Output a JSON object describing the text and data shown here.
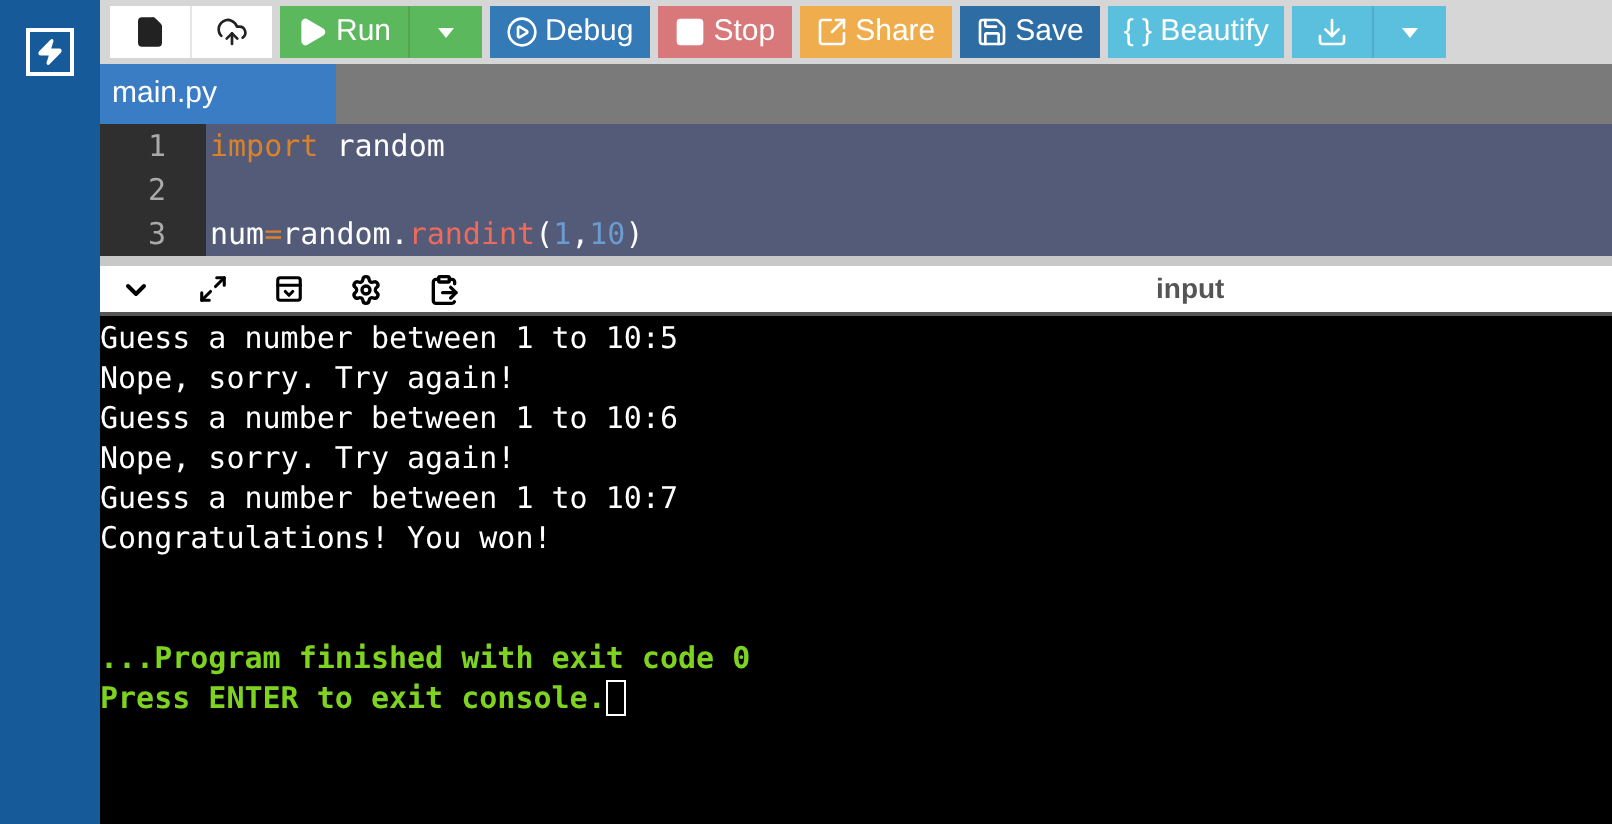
{
  "toolbar": [
    {
      "kind": "new",
      "color": "#ffffff"
    },
    {
      "kind": "upload",
      "color": "#ffffff"
    },
    {
      "kind": "run",
      "label": "Run",
      "color": "#5cb85c"
    },
    {
      "kind": "run-menu",
      "color": "#5cb85c"
    },
    {
      "kind": "debug",
      "label": "Debug",
      "color": "#337ab7"
    },
    {
      "kind": "stop",
      "label": "Stop",
      "color": "#d9787a"
    },
    {
      "kind": "share",
      "label": "Share",
      "color": "#f0ad4e"
    },
    {
      "kind": "save",
      "label": "Save",
      "color": "#2e6da4"
    },
    {
      "kind": "beautify",
      "label": "{ } Beautify",
      "color": "#5bc0de"
    },
    {
      "kind": "download",
      "color": "#5bc0de"
    },
    {
      "kind": "download-menu",
      "color": "#5bc0de"
    }
  ],
  "file_tab": {
    "label": "main.py",
    "selected": true
  },
  "editor": {
    "lines": [
      {
        "number": "1",
        "tokens": [
          {
            "kind": "keyword",
            "text": "import"
          },
          {
            "kind": "plain",
            "text": " random"
          }
        ]
      },
      {
        "number": "2"
      },
      {
        "number": "3",
        "tokens": [
          {
            "kind": "plain",
            "text": "num"
          },
          {
            "kind": "operator",
            "text": "="
          },
          {
            "kind": "plain",
            "text": "random."
          },
          {
            "kind": "function",
            "text": "randint"
          },
          {
            "kind": "plain",
            "text": "("
          },
          {
            "kind": "number",
            "text": "1"
          },
          {
            "kind": "plain",
            "text": ","
          },
          {
            "kind": "number",
            "text": "10"
          },
          {
            "kind": "plain",
            "text": ")"
          }
        ]
      }
    ]
  },
  "console_bar": {
    "label": "input"
  },
  "console": {
    "lines": [
      {
        "kind": "output",
        "text": "Guess a number between 1 to 10:5"
      },
      {
        "kind": "output",
        "text": "Nope, sorry. Try again!"
      },
      {
        "kind": "output",
        "text": "Guess a number between 1 to 10:6"
      },
      {
        "kind": "output",
        "text": "Nope, sorry. Try again!"
      },
      {
        "kind": "output",
        "text": "Guess a number between 1 to 10:7"
      },
      {
        "kind": "output",
        "text": "Congratulations! You won!"
      },
      {
        "kind": "blank"
      },
      {
        "kind": "blank"
      },
      {
        "kind": "status",
        "text": "...Program finished with exit code 0"
      },
      {
        "kind": "prompt",
        "text": "Press ENTER to exit console."
      }
    ]
  }
}
